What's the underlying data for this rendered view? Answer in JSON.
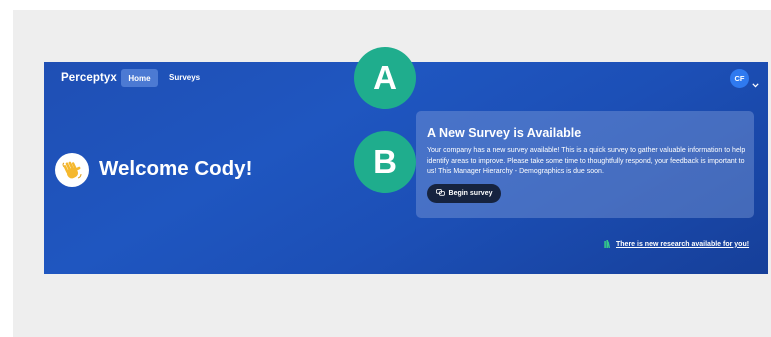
{
  "nav": {
    "brand": "Perceptyx",
    "home_label": "Home",
    "surveys_label": "Surveys",
    "avatar_initials": "CF"
  },
  "hero": {
    "welcome": "Welcome Cody!"
  },
  "survey_card": {
    "title": "A New Survey is Available",
    "body": "Your company has a new survey available! This is a quick survey to gather valuable information to help identify areas to improve. Please take some time to thoughtfully respond, your feedback is important to us! This Manager Hierarchy - Demographics is due soon.",
    "button_label": "Begin survey"
  },
  "research_link": "There is new research available for you!",
  "markers": [
    "A",
    "B"
  ],
  "colors": {
    "banner": "#1f56c0",
    "marker": "#1fad8d",
    "button": "#16233f",
    "avatar": "#2f7af0",
    "research_icon": "#36c98a"
  }
}
